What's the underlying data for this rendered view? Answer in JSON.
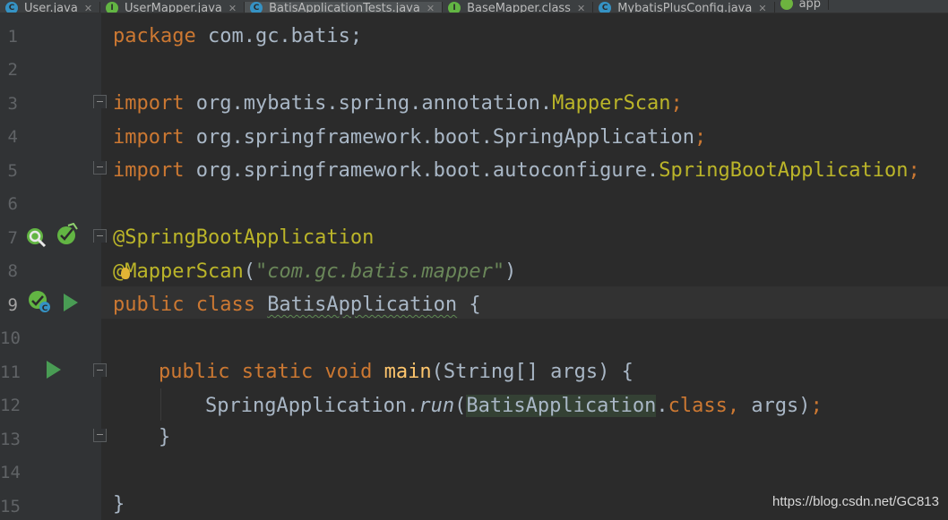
{
  "tabs": [
    {
      "label": "User.java",
      "icon": "class-icon",
      "color": "#3592c4",
      "glyph": "C",
      "active": false
    },
    {
      "label": "UserMapper.java",
      "icon": "interface-icon",
      "color": "#62b543",
      "glyph": "I",
      "active": false
    },
    {
      "label": "BatisApplicationTests.java",
      "icon": "class-icon",
      "color": "#3592c4",
      "glyph": "C",
      "active": true
    },
    {
      "label": "BaseMapper.class",
      "icon": "interface-icon",
      "color": "#62b543",
      "glyph": "I",
      "active": false
    },
    {
      "label": "MybatisPlusConfig.java",
      "icon": "class-icon",
      "color": "#3592c4",
      "glyph": "C",
      "active": false
    },
    {
      "label": "app",
      "icon": "spring-icon",
      "color": "#6db33f",
      "glyph": "",
      "active": false
    }
  ],
  "line_numbers": [
    "1",
    "2",
    "3",
    "4",
    "5",
    "6",
    "7",
    "8",
    "9",
    "10",
    "11",
    "12",
    "13",
    "14",
    "15"
  ],
  "code": {
    "l1_kw": "package",
    "l1_rest": " com.gc.batis;",
    "l3_kw": "import",
    "l3_pkg": " org.mybatis.spring.annotation.",
    "l3_cls": "MapperScan",
    "l3_semi": ";",
    "l4_kw": "import",
    "l4_pkg": " org.springframework.boot.SpringApplication",
    "l4_semi": ";",
    "l5_kw": "import",
    "l5_pkg": " org.springframework.boot.autoconfigure.",
    "l5_cls": "SpringBootApplication",
    "l5_semi": ";",
    "l7_ann": "@SpringBootApplication",
    "l8_ann": "@MapperScan",
    "l8_open": "(",
    "l8_str": "\"com.gc.batis.mapper\"",
    "l8_close": ")",
    "l9_kw": "public class ",
    "l9_name": "BatisApplication",
    "l9_brace": " {",
    "l11_kw": "public static void ",
    "l11_fn": "main",
    "l11_rest": "(String[] args) {",
    "l12_cls": "SpringApplication.",
    "l12_run": "run",
    "l12_open": "(",
    "l12_arg": "BatisApplication",
    "l12_dot": ".",
    "l12_kw": "class,",
    "l12_args": " args)",
    "l12_semi": ";",
    "l13_brace": "}",
    "l15_brace": "}"
  },
  "watermark": "https://blog.csdn.net/GC813"
}
